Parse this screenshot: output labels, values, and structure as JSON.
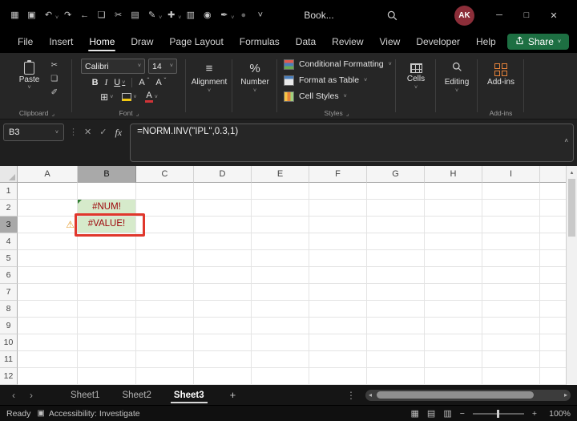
{
  "titlebar": {
    "title": "Book...",
    "avatar_initials": "AK",
    "qat_icons": [
      {
        "name": "app-grid-icon",
        "glyph": "▦"
      },
      {
        "name": "save-icon",
        "glyph": "▣"
      },
      {
        "name": "undo-icon",
        "glyph": "↶",
        "chevron": true
      },
      {
        "name": "redo-icon",
        "glyph": "↷"
      },
      {
        "name": "back-icon",
        "glyph": "←"
      },
      {
        "name": "paste-icon",
        "glyph": "❏"
      },
      {
        "name": "cut-icon",
        "glyph": "✂"
      },
      {
        "name": "keyboard-icon",
        "glyph": "▤"
      },
      {
        "name": "format-painter-icon",
        "glyph": "✎",
        "chevron": true
      },
      {
        "name": "add-icon",
        "glyph": "✚",
        "chevron": true
      },
      {
        "name": "table-icon",
        "glyph": "▥"
      },
      {
        "name": "camera-icon",
        "glyph": "◉"
      },
      {
        "name": "pen-icon",
        "glyph": "✒",
        "chevron": true
      },
      {
        "name": "record-icon",
        "glyph": "●"
      },
      {
        "name": "more-icon",
        "glyph": "˅"
      }
    ],
    "window_controls": [
      {
        "name": "minimize-button",
        "glyph": "─"
      },
      {
        "name": "maximize-button",
        "glyph": "□"
      },
      {
        "name": "close-button",
        "glyph": "✕"
      }
    ]
  },
  "menubar": {
    "items": [
      "File",
      "Insert",
      "Home",
      "Draw",
      "Page Layout",
      "Formulas",
      "Data",
      "Review",
      "View",
      "Developer",
      "Help"
    ],
    "active": "Home",
    "share_label": "Share"
  },
  "ribbon": {
    "clipboard": {
      "paste_label": "Paste",
      "group_label": "Clipboard"
    },
    "font": {
      "family": "Calibri",
      "size": "14",
      "bold": "B",
      "italic": "I",
      "underline": "U",
      "grow": "A",
      "shrink": "A",
      "color_letter": "A",
      "group_label": "Font"
    },
    "alignment": {
      "label": "Alignment"
    },
    "number": {
      "label": "Number"
    },
    "styles": {
      "buttons": [
        "Conditional Formatting",
        "Format as Table",
        "Cell Styles"
      ],
      "group_label": "Styles"
    },
    "cells": {
      "label": "Cells"
    },
    "editing": {
      "label": "Editing"
    },
    "addins": {
      "label": "Add-ins"
    }
  },
  "formula_bar": {
    "name_box": "B3",
    "cancel": "✕",
    "enter": "✓",
    "fx": "fx",
    "formula": "=NORM.INV(\"IPL\",0.3,1)"
  },
  "grid": {
    "columns": [
      "A",
      "B",
      "C",
      "D",
      "E",
      "F",
      "G",
      "H",
      "I"
    ],
    "rows": [
      "1",
      "2",
      "3",
      "4",
      "5",
      "6",
      "7",
      "8",
      "9",
      "10",
      "11",
      "12"
    ],
    "selected_column": "B",
    "selected_row": "3",
    "cells": [
      {
        "ref": "B2",
        "value": "#NUM!",
        "fill": "#d6eacb",
        "text_color": "#9c0006",
        "error_indicator": true
      },
      {
        "ref": "B3",
        "value": "#VALUE!",
        "fill": "#d6eacb",
        "text_color": "#9c0006",
        "annotated": true
      }
    ],
    "warning": {
      "cell": "A3",
      "icon": "error-options-warning-icon",
      "glyph": "⚠"
    }
  },
  "sheet_bar": {
    "tabs": [
      "Sheet1",
      "Sheet2",
      "Sheet3"
    ],
    "active": "Sheet3",
    "add_label": "+"
  },
  "status_bar": {
    "ready": "Ready",
    "accessibility": "Accessibility: Investigate",
    "zoom_percent": "100%"
  },
  "icons": {
    "chevron_down": "˅",
    "chevron_up": "˄",
    "dialog_launcher": "⌟",
    "cut": "✂",
    "copy": "❏",
    "format_painter": "✐",
    "borders": "⊞",
    "align": "≡",
    "percent": "%",
    "grow_caret": "ˆ",
    "shrink_caret": "ˇ",
    "menu_dots": "⋮",
    "nav_left": "‹",
    "nav_right": "›",
    "scroll_left": "◂",
    "scroll_right": "▸",
    "scroll_up": "▴",
    "view_normal": "▦",
    "view_layout": "▤",
    "view_break": "▥",
    "zoom_out": "−",
    "zoom_in": "+",
    "accessibility": "▣"
  },
  "colors": {
    "accent_green": "#1d6f42",
    "highlight_green": "#d6eacb",
    "annotation_red": "#e0372c",
    "error_text": "#9c0006",
    "avatar_bg": "#8c2e39"
  }
}
